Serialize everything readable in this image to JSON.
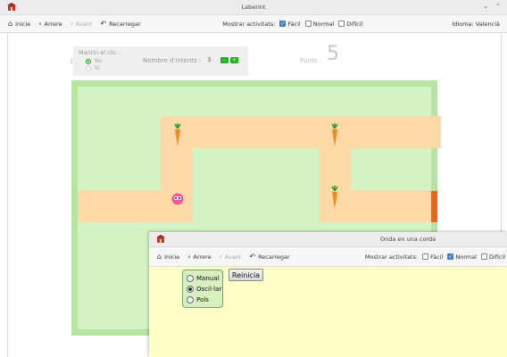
{
  "laberint": {
    "window_title": "Laberint",
    "nav": {
      "home": "Inicie",
      "back": "Arrere",
      "forward": "Avant",
      "reload": "Recarregar"
    },
    "activities": {
      "label": "Mostrar activitats:",
      "options": [
        {
          "label": "Fàcil",
          "checked": true
        },
        {
          "label": "Normal",
          "checked": false
        },
        {
          "label": "Difícil",
          "checked": false
        }
      ]
    },
    "language": {
      "label": "Idioma:",
      "value": "Valencià"
    },
    "hold_click": {
      "label": "Mantín el clic :",
      "options": [
        "No",
        "Sí"
      ],
      "selected": "No"
    },
    "attempts": {
      "label": "Nombre d'intents :",
      "value": "3",
      "minus": "-",
      "plus": "+"
    },
    "score": {
      "label": "Punts :",
      "value": "5"
    },
    "icons": [
      "app-icon",
      "home-icon",
      "back-arrow-icon",
      "forward-arrow-icon",
      "reload-icon",
      "carrot-icon",
      "critter-icon"
    ]
  },
  "onda": {
    "window_title": "Onda en una corda",
    "nav": {
      "home": "Inicie",
      "back": "Arrere",
      "forward": "Avant",
      "reload": "Recarregar"
    },
    "activities": {
      "label": "Mostrar activitats:",
      "options": [
        {
          "label": "Fàcil",
          "checked": false
        },
        {
          "label": "Normal",
          "checked": true
        },
        {
          "label": "Difícil",
          "checked": false
        }
      ]
    },
    "modes": [
      {
        "label": "Manual",
        "selected": false
      },
      {
        "label": "Oscil·lar",
        "selected": true
      },
      {
        "label": "Pols",
        "selected": false
      }
    ],
    "reset_label": "Reinicia"
  },
  "colors": {
    "maze_border": "#b7e4a0",
    "maze_field": "#d4f3c4",
    "path": "#fdd9a8",
    "exit": "#f06414",
    "sim_background": "#ffffc7",
    "checkbox_accent": "#3c7fd6"
  }
}
